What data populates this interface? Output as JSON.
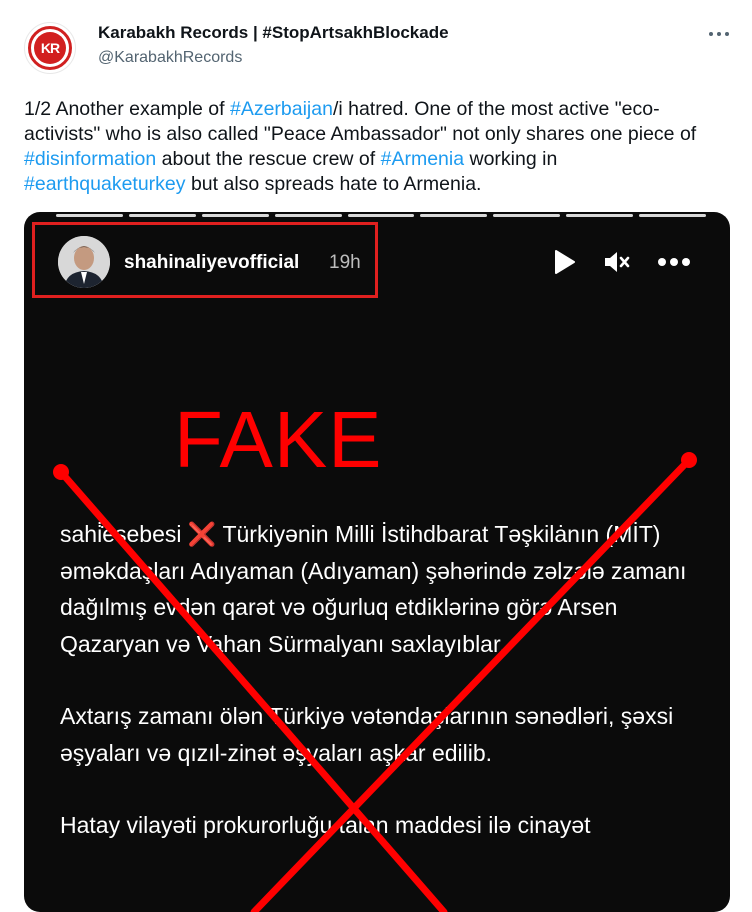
{
  "tweet": {
    "avatar_text": "KR",
    "display_name": "Karabakh Records | #StopArtsakhBlockade",
    "handle": "@KarabakhRecords",
    "more_icon": "ellipsis-icon",
    "body": [
      {
        "t": "1/2 Another example of ",
        "tag": false
      },
      {
        "t": "#Azerbaijan",
        "tag": true
      },
      {
        "t": "/i hatred. One of the most active \"eco-activists\" who is also called \"Peace Ambassador\" not only shares one piece of ",
        "tag": false
      },
      {
        "t": "#disinformation",
        "tag": true
      },
      {
        "t": " about the rescue crew of ",
        "tag": false
      },
      {
        "t": "#Armenia",
        "tag": true
      },
      {
        "t": " working in ",
        "tag": false
      },
      {
        "t": "#earthquaketurkey",
        "tag": true
      },
      {
        "t": " but also spreads hate to Armenia.",
        "tag": false
      }
    ],
    "link_color": "#1d9bf0"
  },
  "media": {
    "username": "shahinaliyevofficial",
    "time": "19h",
    "highlight_color": "#e0201f",
    "stamp": "FAKE",
    "stamp_color": "#ff0000",
    "paragraphs": [
      "sahi̇̇esebesi ❌ Türkiyənin Milli İstihdbarat Təşkilȧnın (MİT) əməkdaşları Adıyaman (Adıyaman) şəhərində zəlzələ zamanı dağılmış evdən qarət və oğurluq etdiklərinə görə Arsen Qazaryan və Vahan Sürmalyanı saxlayıblar.",
      "Axtarış zamanı ölən Türkiyə vətəndaşlarının sənədləri, şəxsi əşyaları və qızıl-zinət əşyaları aşkar edilib.",
      "Hatay vilayəti prokurorluğu talan maddesi ilə cinayət"
    ],
    "icons": [
      "play-icon",
      "mute-icon",
      "more-horizontal-icon"
    ]
  }
}
